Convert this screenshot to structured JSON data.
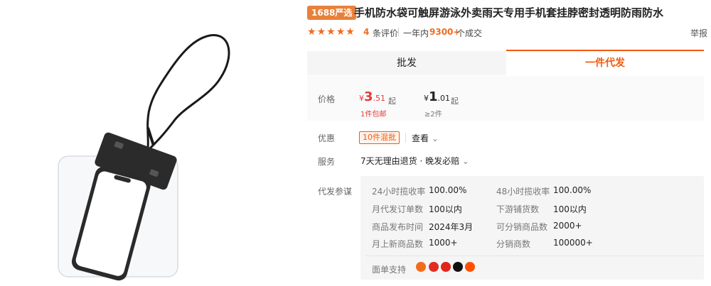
{
  "product": {
    "badge": "1688严选",
    "title": "手机防水袋可触屏游泳外卖雨天专用手机套挂脖密封透明防雨防水"
  },
  "rating": {
    "stars": 5,
    "review_count": "4",
    "review_label": "条评价",
    "year_label": "一年内",
    "deal_count": "9300+",
    "deal_label": "个成交",
    "report_label": "举报"
  },
  "tabs": [
    {
      "label": "批发"
    },
    {
      "label": "一件代发"
    }
  ],
  "price": {
    "label": "价格",
    "tier1": {
      "currency": "¥",
      "int": "3",
      "dec": ".51",
      "unit": "起",
      "note": "1件包邮"
    },
    "tier2": {
      "currency": "¥",
      "int": "1",
      "dec": ".01",
      "unit": "起",
      "note": "≥2件"
    }
  },
  "promo": {
    "label": "优惠",
    "coupon": "10件混批",
    "view_label": "查看",
    "chevron": "⌄"
  },
  "service": {
    "label": "服务",
    "text": "7天无理由退货 · 晚发必赔",
    "chevron": "⌄"
  },
  "dropship": {
    "label": "代发参谋",
    "params": [
      {
        "label": "24小时揽收率",
        "value": "100.00%"
      },
      {
        "label": "48小时揽收率",
        "value": "100.00%"
      },
      {
        "label": "月代发订单数",
        "value": "100以内"
      },
      {
        "label": "下游铺货数",
        "value": "100以内"
      },
      {
        "label": "商品发布时间",
        "value": "2024年3月"
      },
      {
        "label": "可分销商品数",
        "value": "2000+"
      },
      {
        "label": "月上新商品数",
        "value": "1000+"
      },
      {
        "label": "分销商数",
        "value": "100000+"
      }
    ],
    "sheet_label": "面单支持",
    "logos": [
      {
        "icon": "taobao-logo-icon",
        "color": "#f26b1d"
      },
      {
        "icon": "pinduoduo-logo-icon",
        "color": "#e02e24"
      },
      {
        "icon": "jd-logo-icon",
        "color": "#e1251b"
      },
      {
        "icon": "douyin-logo-icon",
        "color": "#111111"
      },
      {
        "icon": "kuaishou-logo-icon",
        "color": "#ff5000"
      }
    ]
  },
  "colors": {
    "accent": "#f25a0a",
    "price": "#e4393c",
    "badge": "#e8813a"
  }
}
